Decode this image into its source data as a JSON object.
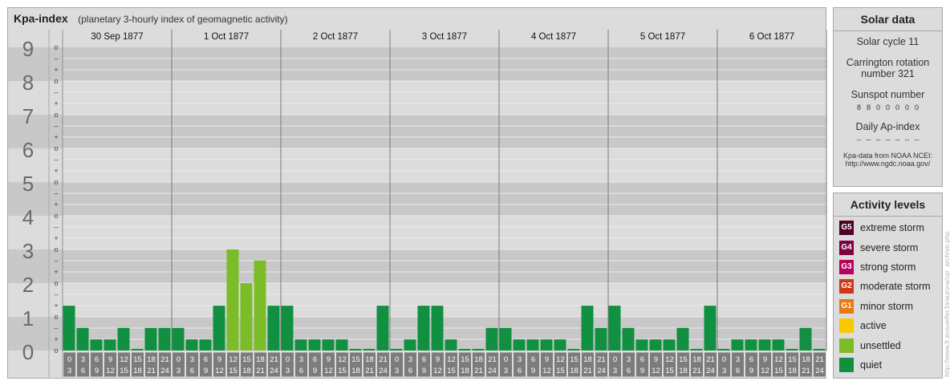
{
  "header": {
    "title": "Kpa-index",
    "subtitle": "(planetary 3-hourly index of geomagnetic activity)"
  },
  "chart_data": {
    "type": "bar",
    "title": "Kpa-index",
    "subtitle": "(planetary 3-hourly index of geomagnetic activity)",
    "ylim": [
      0,
      9
    ],
    "y_ticks": [
      "0",
      "1",
      "2",
      "3",
      "4",
      "5",
      "6",
      "7",
      "8",
      "9"
    ],
    "sub_ticks": [
      "o",
      "+",
      "–"
    ],
    "days": [
      "30 Sep 1877",
      "1 Oct 1877",
      "2 Oct 1877",
      "3 Oct 1877",
      "4 Oct 1877",
      "5 Oct 1877",
      "6 Oct 1877"
    ],
    "interval_labels": [
      [
        "0",
        "3"
      ],
      [
        "3",
        "6"
      ],
      [
        "6",
        "9"
      ],
      [
        "9",
        "12"
      ],
      [
        "12",
        "15"
      ],
      [
        "15",
        "18"
      ],
      [
        "18",
        "21"
      ],
      [
        "21",
        "24"
      ]
    ],
    "values": [
      [
        1.33,
        0.67,
        0.33,
        0.33,
        0.67,
        0,
        0.67,
        0.67
      ],
      [
        0.67,
        0.33,
        0.33,
        1.33,
        3.0,
        2.0,
        2.67,
        1.33
      ],
      [
        1.33,
        0.33,
        0.33,
        0.33,
        0.33,
        0,
        0,
        1.33
      ],
      [
        0,
        0.33,
        1.33,
        1.33,
        0.33,
        0,
        0,
        0.67
      ],
      [
        0.67,
        0.33,
        0.33,
        0.33,
        0.33,
        0,
        1.33,
        0.67
      ],
      [
        1.33,
        0.67,
        0.33,
        0.33,
        0.33,
        0.67,
        0,
        1.33
      ],
      [
        0,
        0.33,
        0.33,
        0.33,
        0.33,
        0,
        0.67,
        0
      ]
    ],
    "colors": {
      "quiet": "#109040",
      "unsettled": "#7cbc28"
    },
    "grid": true
  },
  "solar": {
    "header": "Solar data",
    "cycle": "Solar cycle 11",
    "rotation_line1": "Carrington rotation",
    "rotation_line2": "number 321",
    "sunspot_label": "Sunspot number",
    "sunspot_values": [
      "8",
      "8",
      "0",
      "0",
      "0",
      "0",
      "0"
    ],
    "ap_label": "Daily Ap-index",
    "ap_values": [
      "--",
      "--",
      "--",
      "--",
      "--",
      "--",
      "--"
    ],
    "source_line1": "Kpa-data from NOAA NCEI:",
    "source_line2": "http://www.ngdc.noaa.gov/"
  },
  "activity": {
    "header": "Activity levels",
    "levels": [
      {
        "code": "G5",
        "label": "extreme storm",
        "color": "#500028"
      },
      {
        "code": "G4",
        "label": "severe storm",
        "color": "#800040"
      },
      {
        "code": "G3",
        "label": "strong storm",
        "color": "#b8005c"
      },
      {
        "code": "G2",
        "label": "moderate storm",
        "color": "#d03818"
      },
      {
        "code": "G1",
        "label": "minor storm",
        "color": "#e87810"
      },
      {
        "code": "",
        "label": "active",
        "color": "#f8c800"
      },
      {
        "code": "",
        "label": "unsettled",
        "color": "#7cbc28"
      },
      {
        "code": "",
        "label": "quiet",
        "color": "#109040"
      }
    ]
  },
  "watermark": "http://www.fr.eusuelfer.fa/aurora/cpi_archive.php"
}
